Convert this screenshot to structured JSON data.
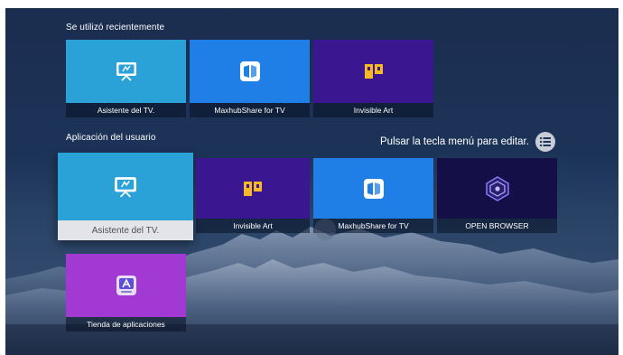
{
  "colors": {
    "assistant_tile": "#2aa2d8",
    "maxhub_tile": "#1f7fe6",
    "invisible_tile": "#3a1791",
    "browser_tile": "#150f47",
    "store_tile": "#a239d2",
    "caption_dark": "rgba(8,16,36,0.55)",
    "caption_focus": "#e2e4e9"
  },
  "recent": {
    "label": "Se utilizó recientemente",
    "apps": [
      {
        "name": "Asistente del TV.",
        "icon": "tv-assistant-icon"
      },
      {
        "name": "MaxhubShare for TV",
        "icon": "maxhub-share-icon"
      },
      {
        "name": "Invisible Art",
        "icon": "invisible-art-icon"
      }
    ]
  },
  "user_apps": {
    "label": "Aplicación del usuario",
    "hint": "Pulsar la tecla menú para editar.",
    "menu_icon": "list-menu-icon",
    "apps": [
      {
        "name": "Asistente del TV.",
        "icon": "tv-assistant-icon",
        "focused": true
      },
      {
        "name": "Invisible Art",
        "icon": "invisible-art-icon"
      },
      {
        "name": "MaxhubShare for TV",
        "icon": "maxhub-share-icon"
      },
      {
        "name": "OPEN BROWSER",
        "icon": "open-browser-icon"
      },
      {
        "name": "Tienda de aplicaciones",
        "icon": "app-store-icon"
      }
    ]
  }
}
